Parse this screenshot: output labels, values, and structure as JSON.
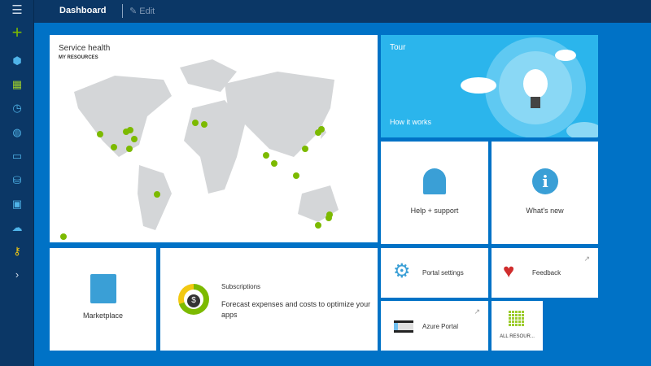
{
  "header": {
    "menu_icon": "hamburger-icon",
    "title": "Dashboard",
    "edit_label": "Edit"
  },
  "sidebar": {
    "items": [
      "new-plus-icon",
      "resource-groups-icon",
      "all-resources-icon",
      "recent-clock-icon",
      "app-services-icon",
      "virtual-machines-icon",
      "sql-databases-icon",
      "cloud-services-icon",
      "storage-cloud-icon",
      "key-icon",
      "expand-chevron-icon"
    ]
  },
  "tiles": {
    "service_health": {
      "title": "Service health",
      "subtitle": "MY RESOURCES"
    },
    "tour": {
      "title": "Tour",
      "link": "How it works"
    },
    "help": {
      "label": "Help + support"
    },
    "whats_new": {
      "label": "What's new"
    },
    "marketplace": {
      "label": "Marketplace"
    },
    "subscriptions": {
      "title": "Subscriptions",
      "description": "Forecast expenses and costs to optimize your apps"
    },
    "portal_settings": {
      "label": "Portal settings"
    },
    "feedback": {
      "label": "Feedback"
    },
    "azure_portal": {
      "label": "Azure Portal"
    },
    "all_resources": {
      "label": "ALL RESOUR..."
    }
  },
  "colors": {
    "topbar": "#0b3766",
    "background": "#0072c6",
    "tour": "#2bb5ec",
    "check": "#7cba00"
  }
}
